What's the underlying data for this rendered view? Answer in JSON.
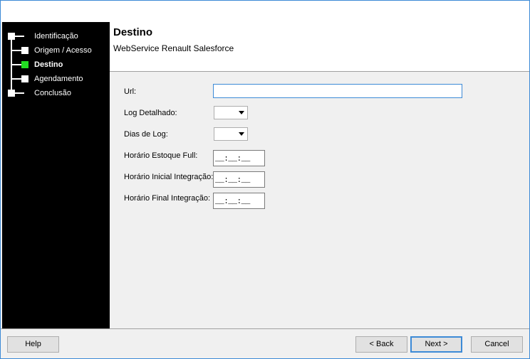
{
  "wizard": {
    "steps": [
      {
        "label": "Identificação",
        "active": false
      },
      {
        "label": "Origem / Acesso",
        "active": false
      },
      {
        "label": "Destino",
        "active": true
      },
      {
        "label": "Agendamento",
        "active": false
      },
      {
        "label": "Conclusão",
        "active": false
      }
    ],
    "active_color": "#22dd22"
  },
  "header": {
    "title": "Destino",
    "subtitle": "WebService Renault Salesforce"
  },
  "form": {
    "url_label": "Url:",
    "url_value": "",
    "log_detalhado_label": "Log Detalhado:",
    "log_detalhado_value": "",
    "dias_log_label": "Dias de Log:",
    "dias_log_value": "",
    "horario_estoque_label": "Horário Estoque Full:",
    "horario_estoque_value": "__:__:__",
    "horario_inicial_label": "Horário Inicial Integração:",
    "horario_inicial_value": "__:__:__",
    "horario_final_label": "Horário Final Integração:",
    "horario_final_value": "__:__:__"
  },
  "footer": {
    "help_label": "Help",
    "back_label": "< Back",
    "next_label": "Next >",
    "cancel_label": "Cancel"
  },
  "colors": {
    "accent": "#3c8ad6",
    "sidebar_bg": "#000000"
  }
}
